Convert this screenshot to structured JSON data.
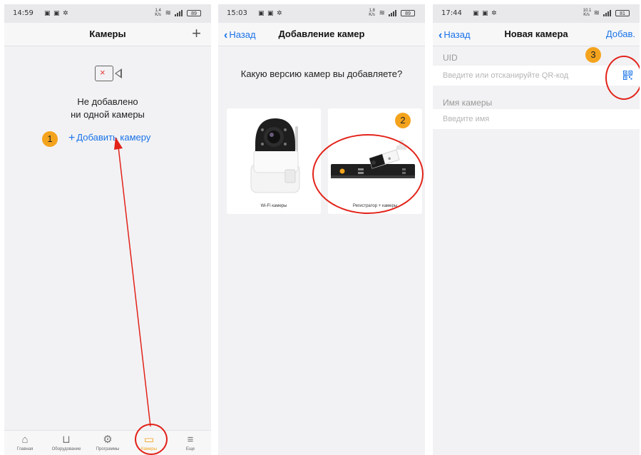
{
  "panel1": {
    "status": {
      "time": "14:59",
      "icons": "▣ ▣ ✲",
      "netspeed": "1.4 K/s",
      "battery": "89"
    },
    "title": "Камеры",
    "plus": "+",
    "empty_line1": "Не добавлено",
    "empty_line2": "ни одной камеры",
    "add_label": "Добавить камеру",
    "badge": "1",
    "tabs": [
      {
        "label": "Главная",
        "icon": "home-icon"
      },
      {
        "label": "Оборудование",
        "icon": "device-icon"
      },
      {
        "label": "Программы",
        "icon": "apps-icon"
      },
      {
        "label": "Камеры",
        "icon": "camera-icon"
      },
      {
        "label": "Еще",
        "icon": "menu-icon"
      }
    ]
  },
  "panel2": {
    "status": {
      "time": "15:03",
      "icons": "▣ ▣ ✲",
      "netspeed": "1.8 K/s",
      "battery": "89"
    },
    "back": "Назад",
    "title": "Добавление камер",
    "question": "Какую версию камер вы добавляете?",
    "card1": "Wi-Fi камеры",
    "card2": "Регистратор + камеры",
    "badge": "2"
  },
  "panel3": {
    "status": {
      "time": "17:44",
      "icons": "▣ ▣ ✲",
      "netspeed": "10.1 K/s",
      "battery": "81"
    },
    "back": "Назад",
    "title": "Новая камера",
    "action": "Добав.",
    "uid_label": "UID",
    "uid_placeholder": "Введите или отсканируйте QR-код",
    "name_label": "Имя камеры",
    "name_placeholder": "Введите имя",
    "badge": "3"
  },
  "colors": {
    "accent": "#1a73e8",
    "badge": "#f4a31c",
    "annotation": "#e2231a"
  }
}
